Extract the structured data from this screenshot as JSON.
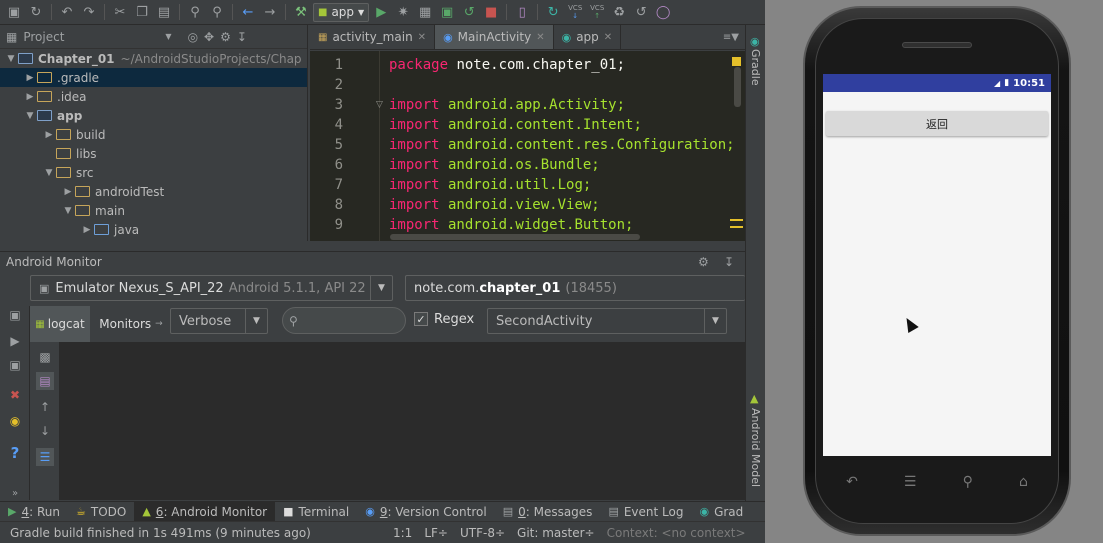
{
  "toolbar": {
    "run_config": "app",
    "vcs1": "VCS",
    "vcs2": "VCS"
  },
  "project_panel": {
    "title": "Project",
    "tree": [
      {
        "label": "Chapter_01",
        "extra": "~/AndroidStudioProjects/Chap",
        "expanded": true,
        "level": 0
      },
      {
        "label": ".gradle",
        "level": 1
      },
      {
        "label": ".idea",
        "level": 1
      },
      {
        "label": "app",
        "level": 1,
        "expanded": true
      },
      {
        "label": "build",
        "level": 2
      },
      {
        "label": "libs",
        "level": 2
      },
      {
        "label": "src",
        "level": 2,
        "expanded": true
      },
      {
        "label": "androidTest",
        "level": 3
      },
      {
        "label": "main",
        "level": 3,
        "expanded": true
      },
      {
        "label": "java",
        "level": 4
      }
    ]
  },
  "editor": {
    "tabs": [
      "activity_main",
      "MainActivity",
      "app"
    ],
    "line_numbers": [
      "1",
      "2",
      "3",
      "4",
      "5",
      "6",
      "7",
      "8",
      "9"
    ],
    "lines": [
      {
        "kw": "package",
        "body": " note.com.chapter_01;"
      },
      {
        "kw": "",
        "body": ""
      },
      {
        "kw": "import",
        "body": " android.app.Activity;"
      },
      {
        "kw": "import",
        "body": " android.content.Intent;"
      },
      {
        "kw": "import",
        "body": " android.content.res.Configuration;"
      },
      {
        "kw": "import",
        "body": " android.os.Bundle;"
      },
      {
        "kw": "import",
        "body": " android.util.Log;"
      },
      {
        "kw": "import",
        "body": " android.view.View;"
      },
      {
        "kw": "import",
        "body": " android.widget.Button;"
      }
    ]
  },
  "side_labels": {
    "gradle": "Gradle",
    "android_model": "Android Model"
  },
  "monitor": {
    "title": "Android Monitor",
    "device": "Emulator Nexus_S_API_22",
    "device_detail": "Android 5.1.1, API 22",
    "process": "note.com.",
    "process_bold": "chapter_01",
    "process_pid": "(18455)",
    "tab_logcat": "logcat",
    "tab_monitors": "Monitors",
    "log_level": "Verbose",
    "regex_label": "Regex",
    "filter": "SecondActivity"
  },
  "tool_tabs": [
    {
      "num": "4",
      "label": ": Run"
    },
    {
      "num": "",
      "label": "TODO"
    },
    {
      "num": "6",
      "label": ": Android Monitor"
    },
    {
      "num": "",
      "label": "Terminal"
    },
    {
      "num": "9",
      "label": ": Version Control"
    },
    {
      "num": "0",
      "label": ": Messages"
    },
    {
      "num": "",
      "label": "Event Log"
    },
    {
      "num": "",
      "label": "Grad"
    }
  ],
  "status": {
    "message": "Gradle build finished in 1s 491ms (9 minutes ago)",
    "position": "1:1",
    "line_sep": "LF÷",
    "encoding": "UTF-8÷",
    "git": "Git: master÷",
    "context": "Context: <no context>"
  },
  "phone": {
    "time": "10:51",
    "button_label": "返回"
  },
  "colors": {
    "accent": "#303f9f",
    "keyword": "#f92672",
    "package": "#a6e22e"
  }
}
